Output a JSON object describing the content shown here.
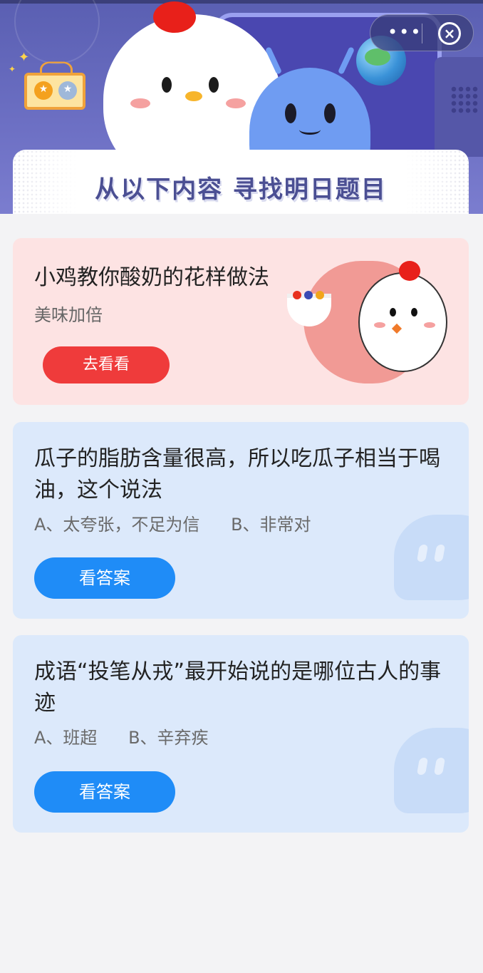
{
  "header": {
    "banner_title": "从以下内容  寻找明日题目",
    "capsule": {
      "more_icon": "more-dots-icon",
      "close_icon": "close-circle-icon"
    }
  },
  "promo_card": {
    "title": "小鸡教你酸奶的花样做法",
    "subtitle": "美味加倍",
    "button_label": "去看看"
  },
  "quiz_cards": [
    {
      "question": "瓜子的脂肪含量很高，所以吃瓜子相当于喝油，这个说法",
      "option_a": "A、太夸张，不足为信",
      "option_b": "B、非常对",
      "button_label": "看答案"
    },
    {
      "question": "成语“投笔从戎”最开始说的是哪位古人的事迹",
      "option_a": "A、班超",
      "option_b": "B、辛弃疾",
      "button_label": "看答案"
    }
  ],
  "colors": {
    "banner": "#5a5fb2",
    "promo_bg": "#fde3e3",
    "promo_button": "#ef3b3b",
    "quiz_bg": "#dce9fb",
    "quiz_button": "#1f8cf7"
  }
}
